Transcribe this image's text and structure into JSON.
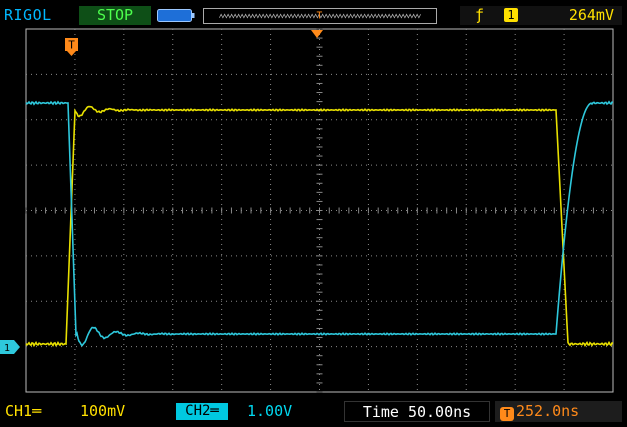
{
  "header": {
    "brand": "RIGOL",
    "run_state": "STOP",
    "battery_icon": "battery-icon",
    "trigger": {
      "edge_symbol": "ƒ",
      "channel": "1",
      "level": "264mV"
    }
  },
  "markers": {
    "trigger_top": "T",
    "trigger_screen": "T",
    "ch1_ground": "1"
  },
  "footer": {
    "ch1_label": "CH1═",
    "ch1_scale": "100mV",
    "ch2_label": "CH2═",
    "ch2_scale": "1.00V",
    "timebase": "Time 50.00ns",
    "trigger_position": "252.0ns"
  },
  "colors": {
    "ch1": "#e8e000",
    "ch2": "#2ec8dc",
    "grid": "#8a8a8a",
    "trigger": "#ff8a1a"
  }
}
